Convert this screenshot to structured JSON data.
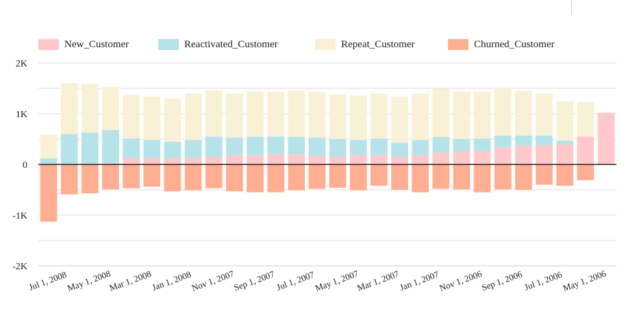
{
  "chart_data": {
    "type": "bar",
    "stacked": true,
    "x": [
      "Jul 1, 2008",
      "Jun 1, 2008",
      "May 1, 2008",
      "Apr 1, 2008",
      "Mar 1, 2008",
      "Feb 1, 2008",
      "Jan 1, 2008",
      "Dec 1, 2007",
      "Nov 1, 2007",
      "Oct 1, 2007",
      "Sep 1, 2007",
      "Aug 1, 2007",
      "Jul 1, 2007",
      "Jun 1, 2007",
      "May 1, 2007",
      "Apr 1, 2007",
      "Mar 1, 2007",
      "Feb 1, 2007",
      "Jan 1, 2007",
      "Dec 1, 2006",
      "Nov 1, 2006",
      "Oct 1, 2006",
      "Sep 1, 2006",
      "Aug 1, 2006",
      "Jul 1, 2006",
      "Jun 1, 2006",
      "May 1, 2006",
      "Apr 1, 2006"
    ],
    "x_tick_labels": [
      "Jul 1, 2008",
      "May 1, 2008",
      "Mar 1, 2008",
      "Jan 1, 2008",
      "Nov 1, 2007",
      "Sep 1, 2007",
      "Jul 1, 2007",
      "May 1, 2007",
      "Mar 1, 2007",
      "Jan 1, 2007",
      "Nov 1, 2006",
      "Sep 1, 2006",
      "Jul 1, 2006",
      "May 1, 2006"
    ],
    "series": [
      {
        "name": "New_Customer",
        "color": "#ffc9cc",
        "values": [
          10,
          10,
          10,
          30,
          130,
          130,
          120,
          130,
          150,
          180,
          180,
          200,
          200,
          170,
          150,
          180,
          180,
          150,
          180,
          230,
          250,
          270,
          340,
          370,
          380,
          390,
          550,
          1020
        ]
      },
      {
        "name": "Reactivated_Customer",
        "color": "#b6e2e9",
        "values": [
          110,
          590,
          620,
          650,
          380,
          350,
          330,
          350,
          400,
          350,
          370,
          350,
          340,
          360,
          350,
          300,
          330,
          280,
          300,
          310,
          250,
          240,
          230,
          200,
          190,
          80,
          0,
          0
        ]
      },
      {
        "name": "Repeat_Customer",
        "color": "#f9f1d6",
        "values": [
          470,
          1000,
          960,
          850,
          860,
          860,
          850,
          920,
          910,
          870,
          890,
          880,
          920,
          900,
          880,
          880,
          890,
          900,
          920,
          950,
          940,
          920,
          930,
          880,
          830,
          780,
          680,
          0
        ]
      },
      {
        "name": "Churned_Customer",
        "color": "#ffae92",
        "values": [
          -1130,
          -590,
          -570,
          -490,
          -470,
          -440,
          -530,
          -510,
          -470,
          -530,
          -550,
          -550,
          -510,
          -480,
          -460,
          -510,
          -420,
          -500,
          -550,
          -480,
          -490,
          -550,
          -490,
          -500,
          -400,
          -420,
          -310,
          0
        ]
      }
    ],
    "y_ticks": [
      2000,
      1000,
      0,
      -1000,
      -2000
    ],
    "y_tick_labels": [
      "2K",
      "1K",
      "0",
      "-1K",
      "-2K"
    ],
    "ylim": [
      -2000,
      2000
    ],
    "grid": true,
    "legend_position": "top",
    "title": "",
    "xlabel": "",
    "ylabel": ""
  }
}
